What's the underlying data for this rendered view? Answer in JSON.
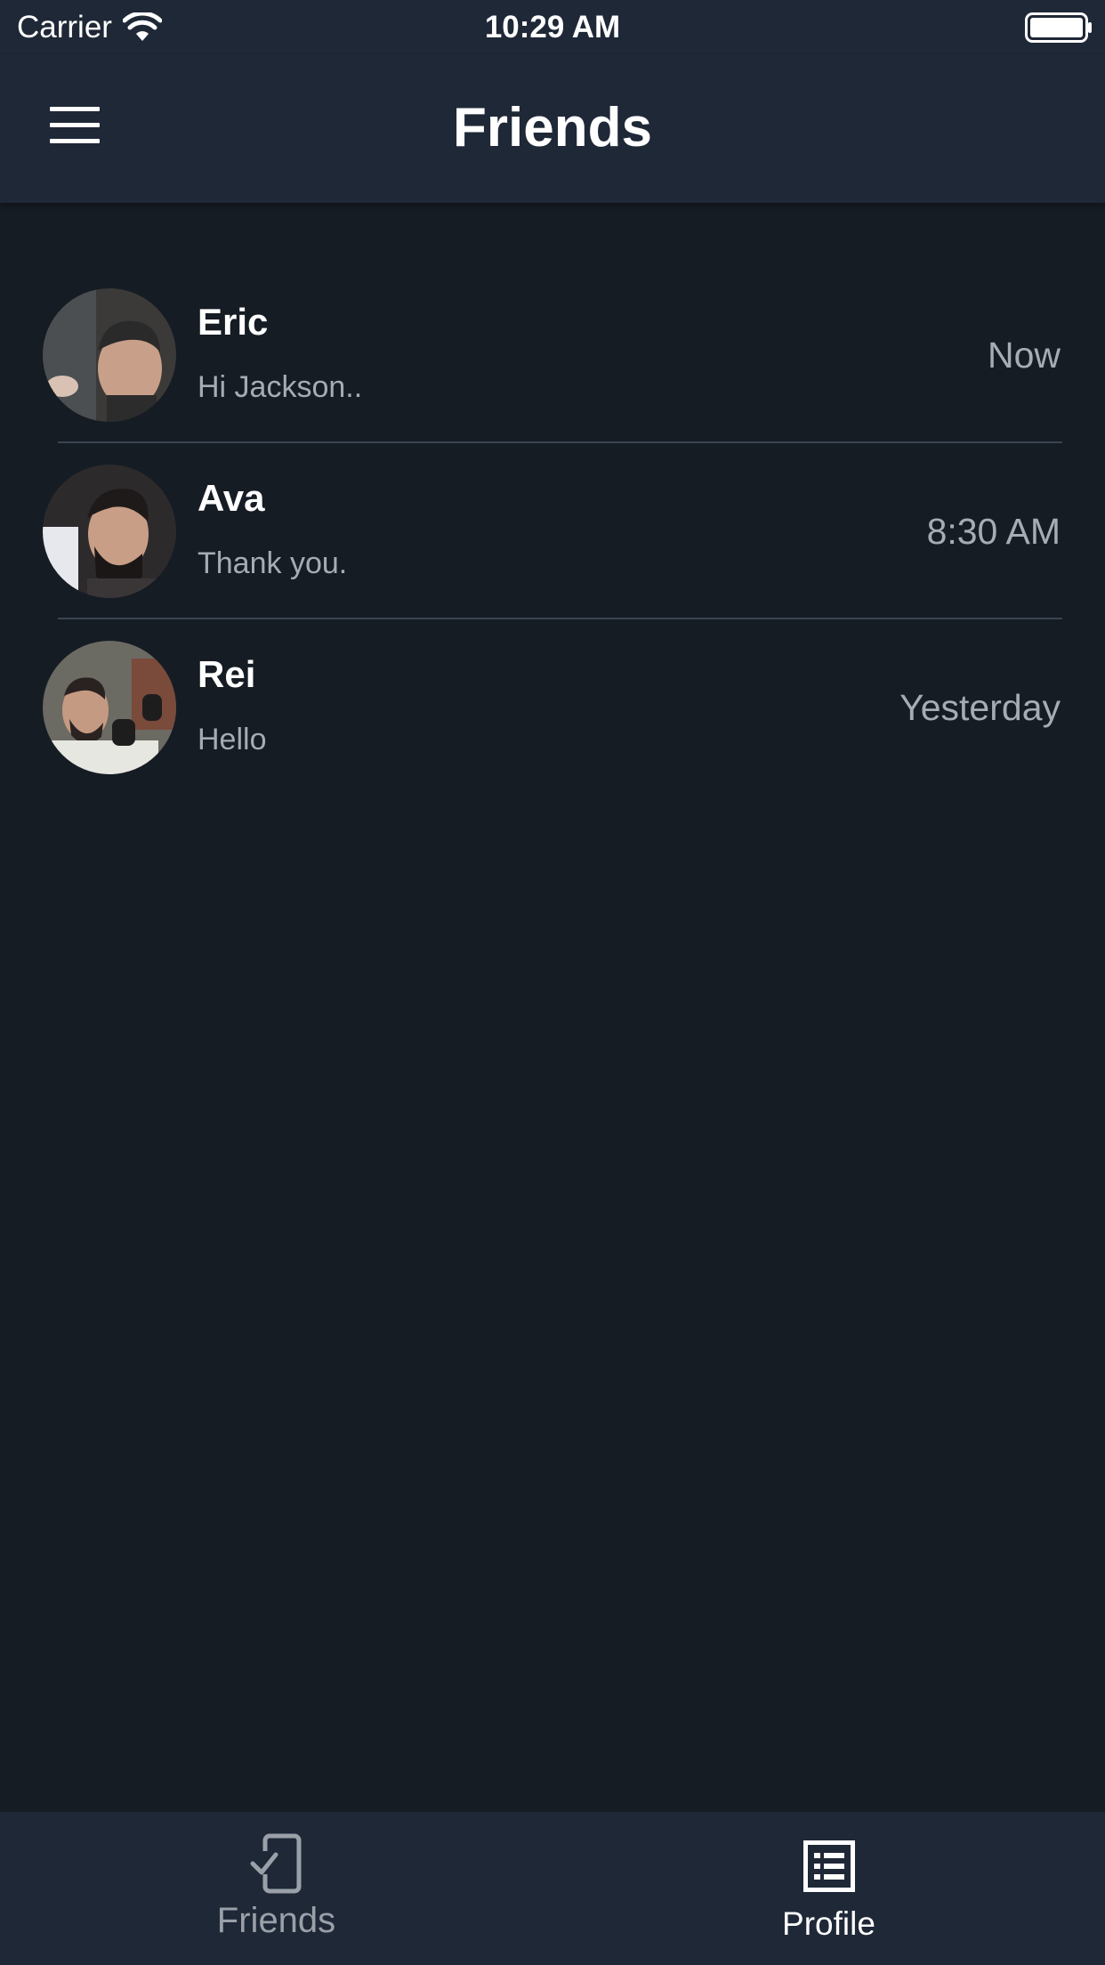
{
  "status_bar": {
    "carrier": "Carrier",
    "time": "10:29 AM",
    "wifi_icon": "wifi-icon",
    "battery_icon": "battery-icon"
  },
  "nav": {
    "title": "Friends",
    "menu_icon": "hamburger-menu-icon"
  },
  "chats": [
    {
      "name": "Eric",
      "preview": "Hi Jackson..",
      "time": "Now"
    },
    {
      "name": "Ava",
      "preview": "Thank you.",
      "time": "8:30 AM"
    },
    {
      "name": "Rei",
      "preview": "Hello",
      "time": "Yesterday"
    }
  ],
  "tabs": [
    {
      "label": "Friends",
      "icon": "phone-check-icon",
      "active": false
    },
    {
      "label": "Profile",
      "icon": "list-document-icon",
      "active": true
    }
  ],
  "colors": {
    "background": "#151c24",
    "bar": "#1f2837",
    "text_primary": "#ffffff",
    "text_secondary": "#a7acb3",
    "divider": "#3a4451"
  }
}
